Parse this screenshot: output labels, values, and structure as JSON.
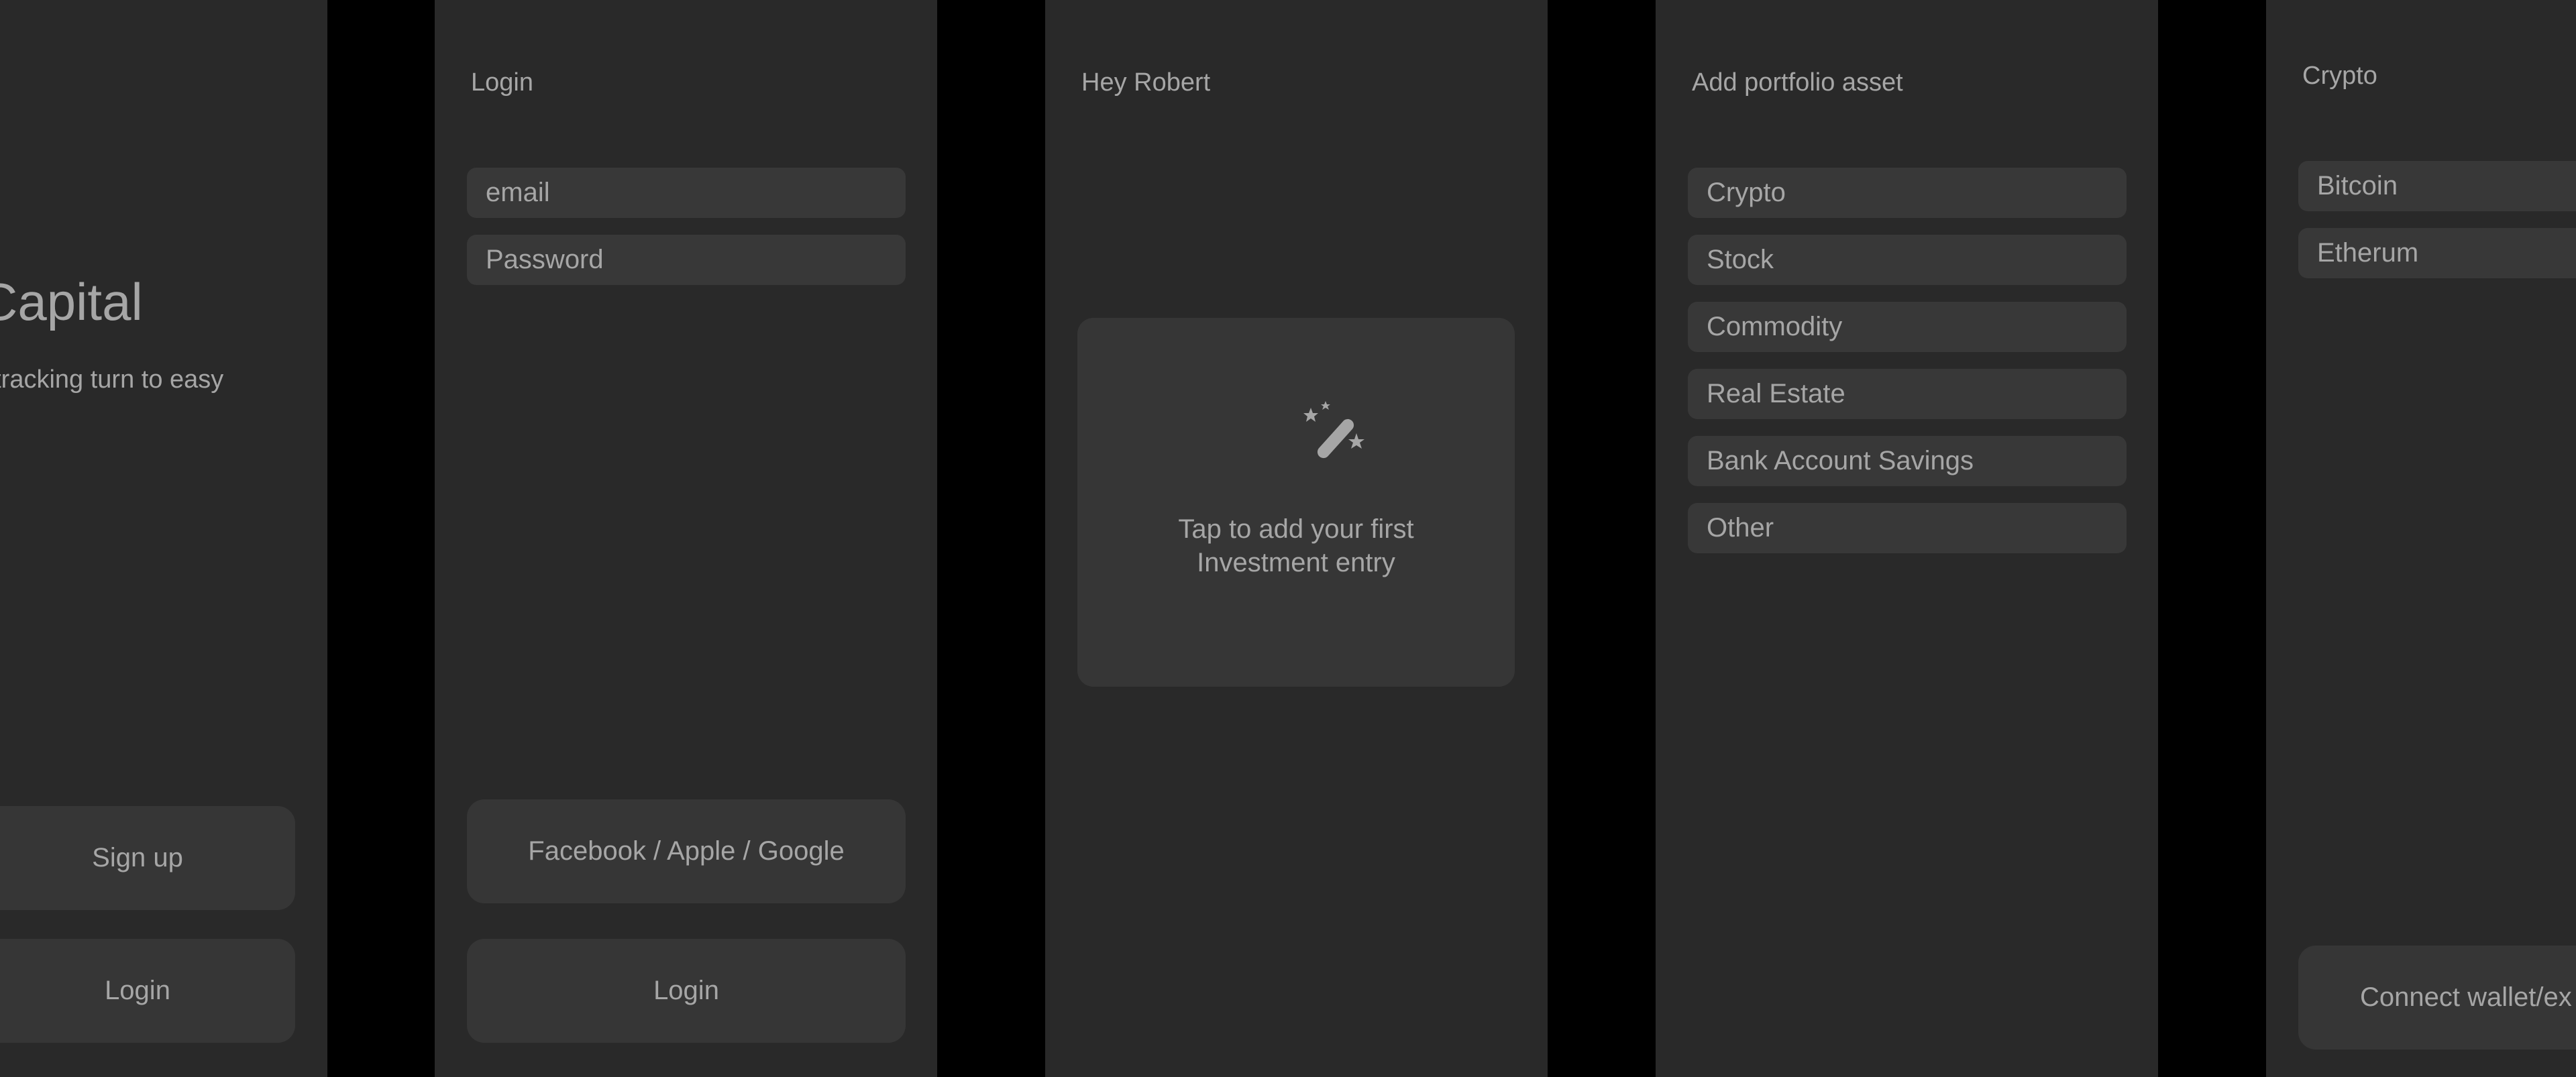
{
  "welcome": {
    "brand": "Capital",
    "tagline": "t tracking turn to easy",
    "signup_label": "Sign up",
    "login_label": "Login"
  },
  "login": {
    "title": "Login",
    "email_placeholder": "email",
    "password_placeholder": "Password",
    "social_label": "Facebook / Apple / Google",
    "login_label": "Login"
  },
  "home": {
    "greeting": "Hey Robert",
    "empty_icon": "magic-wand-icon",
    "empty_line1": "Tap to add your first",
    "empty_line2": "Investment entry"
  },
  "add_asset": {
    "title": "Add portfolio asset",
    "options": [
      "Crypto",
      "Stock",
      "Commodity",
      "Real Estate",
      "Bank Account Savings",
      "Other"
    ]
  },
  "crypto": {
    "title": "Crypto",
    "options": [
      "Bitcoin",
      "Etherum"
    ],
    "connect_label": "Connect wallet/ex"
  },
  "colors": {
    "background": "#000000",
    "screen": "#292929",
    "control": "#383838",
    "text": "#a6a6a6"
  }
}
